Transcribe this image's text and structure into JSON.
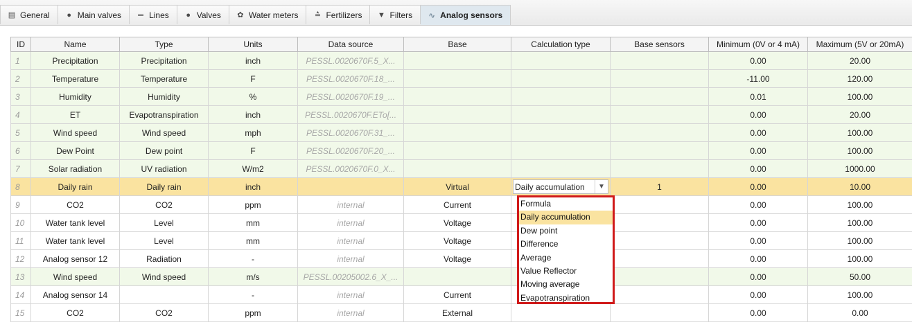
{
  "tabs": [
    {
      "label": "General",
      "icon": "general-icon",
      "glyph": "▤"
    },
    {
      "label": "Main valves",
      "icon": "drop-icon",
      "glyph": "●"
    },
    {
      "label": "Lines",
      "icon": "lines-icon",
      "glyph": "═"
    },
    {
      "label": "Valves",
      "icon": "drop-icon",
      "glyph": "●"
    },
    {
      "label": "Water meters",
      "icon": "water-meter-icon",
      "glyph": "✿"
    },
    {
      "label": "Fertilizers",
      "icon": "fertilizer-icon",
      "glyph": "≛"
    },
    {
      "label": "Filters",
      "icon": "filter-icon",
      "glyph": "▼"
    },
    {
      "label": "Analog sensors",
      "icon": "waveform-icon",
      "glyph": "∿"
    }
  ],
  "active_tab": 7,
  "columns": [
    "ID",
    "Name",
    "Type",
    "Units",
    "Data source",
    "Base",
    "Calculation type",
    "Base sensors",
    "Minimum (0V or 4 mA)",
    "Maximum (5V or 20mA)"
  ],
  "rows": [
    {
      "id": "1",
      "name": "Precipitation",
      "type": "Precipitation",
      "units": "inch",
      "source": "PESSL.0020670F.5_X...",
      "base": "",
      "calc": "",
      "base_sensors": "",
      "min": "0.00",
      "max": "20.00",
      "style": "green"
    },
    {
      "id": "2",
      "name": "Temperature",
      "type": "Temperature",
      "units": "F",
      "source": "PESSL.0020670F.18_...",
      "base": "",
      "calc": "",
      "base_sensors": "",
      "min": "-11.00",
      "max": "120.00",
      "style": "green"
    },
    {
      "id": "3",
      "name": "Humidity",
      "type": "Humidity",
      "units": "%",
      "source": "PESSL.0020670F.19_...",
      "base": "",
      "calc": "",
      "base_sensors": "",
      "min": "0.01",
      "max": "100.00",
      "style": "green"
    },
    {
      "id": "4",
      "name": "ET",
      "type": "Evapotranspiration",
      "units": "inch",
      "source": "PESSL.0020670F.ETo[...",
      "base": "",
      "calc": "",
      "base_sensors": "",
      "min": "0.00",
      "max": "20.00",
      "style": "green"
    },
    {
      "id": "5",
      "name": "Wind speed",
      "type": "Wind speed",
      "units": "mph",
      "source": "PESSL.0020670F.31_...",
      "base": "",
      "calc": "",
      "base_sensors": "",
      "min": "0.00",
      "max": "100.00",
      "style": "green"
    },
    {
      "id": "6",
      "name": "Dew Point",
      "type": "Dew point",
      "units": "F",
      "source": "PESSL.0020670F.20_...",
      "base": "",
      "calc": "",
      "base_sensors": "",
      "min": "0.00",
      "max": "100.00",
      "style": "green"
    },
    {
      "id": "7",
      "name": "Solar radiation",
      "type": "UV radiation",
      "units": "W/m2",
      "source": "PESSL.0020670F.0_X...",
      "base": "",
      "calc": "",
      "base_sensors": "",
      "min": "0.00",
      "max": "1000.00",
      "style": "green"
    },
    {
      "id": "8",
      "name": "Daily rain",
      "type": "Daily rain",
      "units": "inch",
      "source": "",
      "base": "Virtual",
      "calc": "Daily accumulation",
      "base_sensors": "1",
      "min": "0.00",
      "max": "10.00",
      "style": "sel"
    },
    {
      "id": "9",
      "name": "CO2",
      "type": "CO2",
      "units": "ppm",
      "source": "internal",
      "base": "Current",
      "calc": "",
      "base_sensors": "",
      "min": "0.00",
      "max": "100.00",
      "style": "plain"
    },
    {
      "id": "10",
      "name": "Water tank level",
      "type": "Level",
      "units": "mm",
      "source": "internal",
      "base": "Voltage",
      "calc": "",
      "base_sensors": "",
      "min": "0.00",
      "max": "100.00",
      "style": "plain"
    },
    {
      "id": "11",
      "name": "Water tank level",
      "type": "Level",
      "units": "mm",
      "source": "internal",
      "base": "Voltage",
      "calc": "",
      "base_sensors": "",
      "min": "0.00",
      "max": "100.00",
      "style": "plain"
    },
    {
      "id": "12",
      "name": "Analog sensor 12",
      "type": "Radiation",
      "units": "-",
      "source": "internal",
      "base": "Voltage",
      "calc": "",
      "base_sensors": "",
      "min": "0.00",
      "max": "100.00",
      "style": "plain"
    },
    {
      "id": "13",
      "name": "Wind speed",
      "type": "Wind speed",
      "units": "m/s",
      "source": "PESSL.00205002.6_X_...",
      "base": "",
      "calc": "",
      "base_sensors": "",
      "min": "0.00",
      "max": "50.00",
      "style": "green"
    },
    {
      "id": "14",
      "name": "Analog sensor 14",
      "type": "",
      "units": "-",
      "source": "internal",
      "base": "Current",
      "calc": "",
      "base_sensors": "",
      "min": "0.00",
      "max": "100.00",
      "style": "plain"
    },
    {
      "id": "15",
      "name": "CO2",
      "type": "CO2",
      "units": "ppm",
      "source": "internal",
      "base": "External",
      "calc": "",
      "base_sensors": "",
      "min": "0.00",
      "max": "0.00",
      "style": "plain"
    }
  ],
  "calc_options": [
    "Formula",
    "Daily accumulation",
    "Dew point",
    "Difference",
    "Average",
    "Value Reflector",
    "Moving average",
    "Evapotranspiration"
  ],
  "calc_selected": 1
}
